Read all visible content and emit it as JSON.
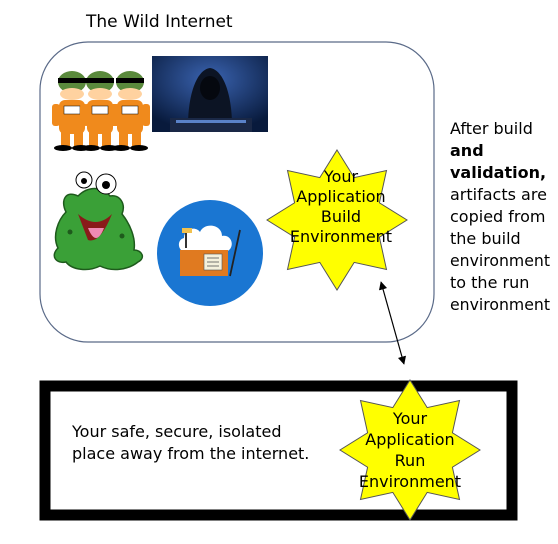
{
  "internet": {
    "title": "The Wild Internet"
  },
  "build_env": {
    "line1": "Your",
    "line2": "Application",
    "line3": "Build",
    "line4": "Environment"
  },
  "run_env": {
    "line1": "Your",
    "line2": "Application",
    "line3": "Run",
    "line4": "Environment"
  },
  "isolated": {
    "line1": "Your safe, secure, isolated",
    "line2": "place away from the internet."
  },
  "note": {
    "line1": "After build",
    "line2": "and",
    "line3": "validation,",
    "line4": "artifacts are",
    "line5": "copied from",
    "line6": "the build",
    "line7": "environment",
    "line8": "to the run",
    "line9": "environment"
  },
  "icons": {
    "robbers": "burglar-trio-icon",
    "hacker": "hooded-hacker-icon",
    "monster": "green-monster-icon",
    "construction": "cloud-construction-icon"
  },
  "colors": {
    "star_fill": "#ffff00",
    "star_stroke": "#555555",
    "circle_blue": "#1a76d2",
    "box_border": "#000000",
    "cloud_border": "#5a6a88"
  }
}
